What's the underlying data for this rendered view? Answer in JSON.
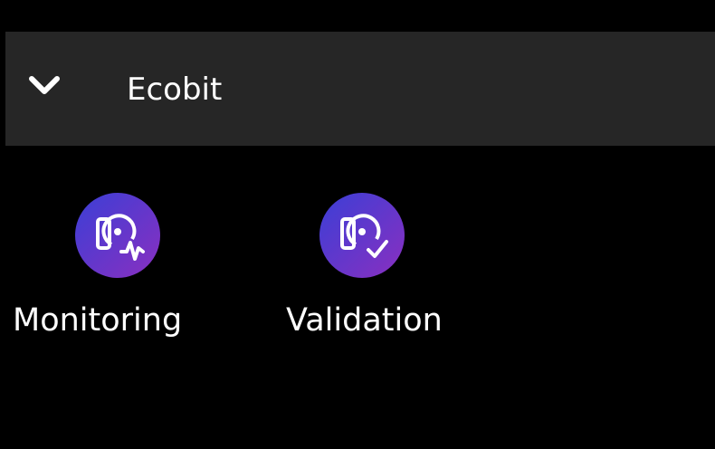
{
  "group": {
    "title": "Ecobit",
    "toggle_icon": "chevron-down-icon"
  },
  "apps": [
    {
      "label": "Monitoring",
      "icon": "disk-monitoring-icon"
    },
    {
      "label": "Validation",
      "icon": "disk-validation-icon"
    }
  ],
  "colors": {
    "background": "#000000",
    "header": "#262626",
    "text": "#ffffff",
    "icon_gradient_start": "#3b3fd6",
    "icon_gradient_end": "#8a2fc0"
  }
}
